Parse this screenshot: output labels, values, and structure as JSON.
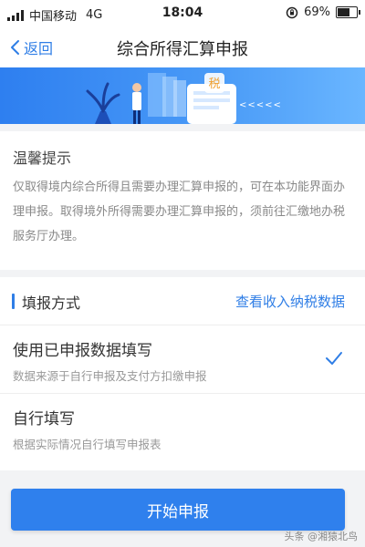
{
  "status_bar": {
    "carrier": "中国移动",
    "network": "4G",
    "time": "18:04",
    "battery": "69%",
    "battery_level": 0.69
  },
  "nav": {
    "back_label": "返回",
    "title": "综合所得汇算申报"
  },
  "banner": {
    "tax_glyph": "税",
    "chevrons": "<<<<<"
  },
  "notice": {
    "title": "温馨提示",
    "text": "仅取得境内综合所得且需要办理汇算申报的，可在本功能界面办理申报。取得境外所得需要办理汇算申报的，须前往汇缴地办税服务厅办理。"
  },
  "method": {
    "title": "填报方式",
    "link": "查看收入纳税数据",
    "options": [
      {
        "title": "使用已申报数据填写",
        "desc": "数据来源于自行申报及支付方扣缴申报",
        "selected": true
      },
      {
        "title": "自行填写",
        "desc": "根据实际情况自行填写申报表",
        "selected": false
      }
    ]
  },
  "start_button": "开始申报",
  "watermark": "头条 @湘猿北鸟",
  "colors": {
    "accent": "#2f7ee6",
    "button": "#2f80ed",
    "background": "#f2f3f5"
  }
}
